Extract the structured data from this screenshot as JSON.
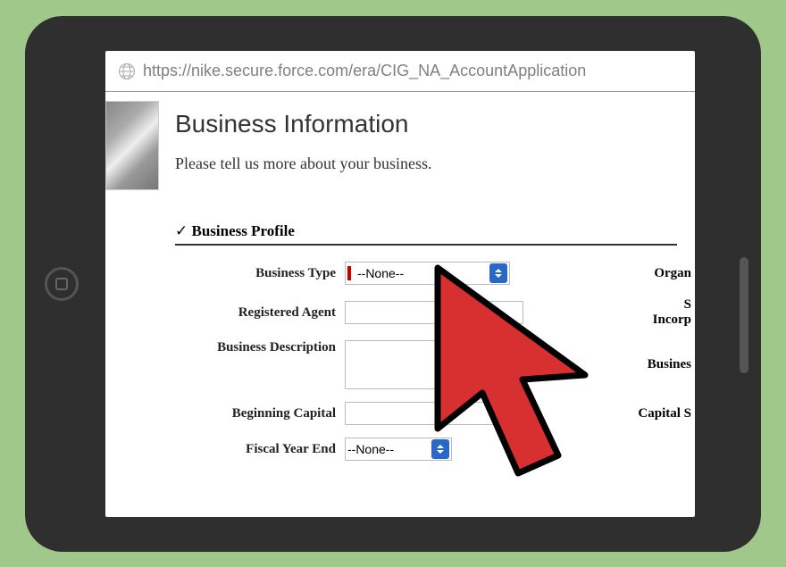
{
  "url": "https://nike.secure.force.com/era/CIG_NA_AccountApplication",
  "page": {
    "title": "Business Information",
    "subtitle": "Please tell us more about your business."
  },
  "section": {
    "header": "Business Profile"
  },
  "form": {
    "business_type": {
      "label": "Business Type",
      "value": "--None--"
    },
    "registered_agent": {
      "label": "Registered Agent",
      "value": ""
    },
    "business_description": {
      "label": "Business Description",
      "value": ""
    },
    "beginning_capital": {
      "label": "Beginning Capital",
      "value": ""
    },
    "fiscal_year_end": {
      "label": "Fiscal Year End",
      "value": "--None--"
    }
  },
  "right_column": {
    "organization": "Organ",
    "s": "S",
    "incorp": "Incorp",
    "busines": "Busines",
    "capital_s": "Capital S"
  }
}
